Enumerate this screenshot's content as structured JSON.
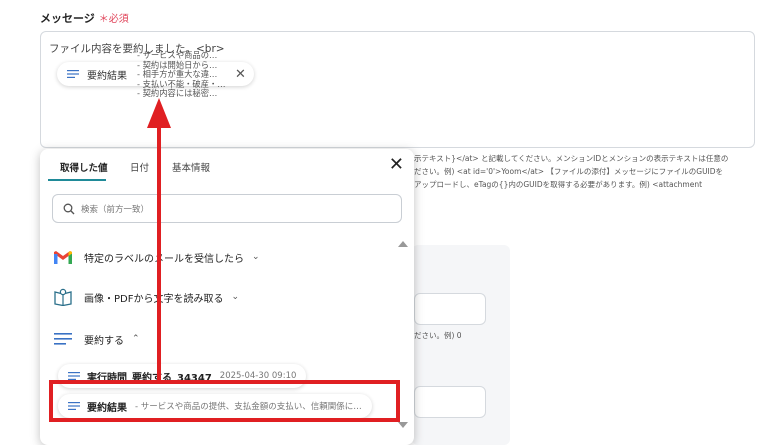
{
  "field": {
    "label": "メッセージ",
    "required": "＊必須"
  },
  "textarea": {
    "line1": "ファイル内容を要約しました。<br>"
  },
  "chip": {
    "label": "要約結果",
    "preview": "- サービスや商品の…\n- 契約は開始日から…\n- 相手方が重大な違…\n- 支払い不能・破産・…\n- 契約内容には秘密…"
  },
  "background_text": {
    "line1": "示テキスト}</at> と記載してください。メンションIDとメンションの表示テキストは任意の",
    "line2": "ださい。例) <at id='0'>Yoom</at> 【ファイルの添付】メッセージにファイルのGUIDを",
    "line3": "アップロードし、eTagの{}内のGUIDを取得する必要があります。例) <attachment",
    "line4": "ださい。例) 0"
  },
  "popup": {
    "tabs": [
      "取得した値",
      "日付",
      "基本情報"
    ],
    "search_placeholder": "検索（前方一致）",
    "groups": [
      {
        "label": "特定のラベルのメールを受信したら",
        "icon": "gmail-icon"
      },
      {
        "label": "画像・PDFから文字を読み取る",
        "icon": "book-ocr-icon"
      },
      {
        "label": "要約する",
        "icon": "lines-icon"
      }
    ],
    "items": [
      {
        "label": "実行時間_要約する_34347",
        "value": "2025-04-30 09:10"
      },
      {
        "label": "要約結果",
        "value": "- サービスや商品の提供、支払金額の支払い、信頼関係に…"
      }
    ]
  },
  "colors": {
    "accent": "#1f8a98",
    "required": "#e0445a",
    "highlight": "#e01f22"
  }
}
